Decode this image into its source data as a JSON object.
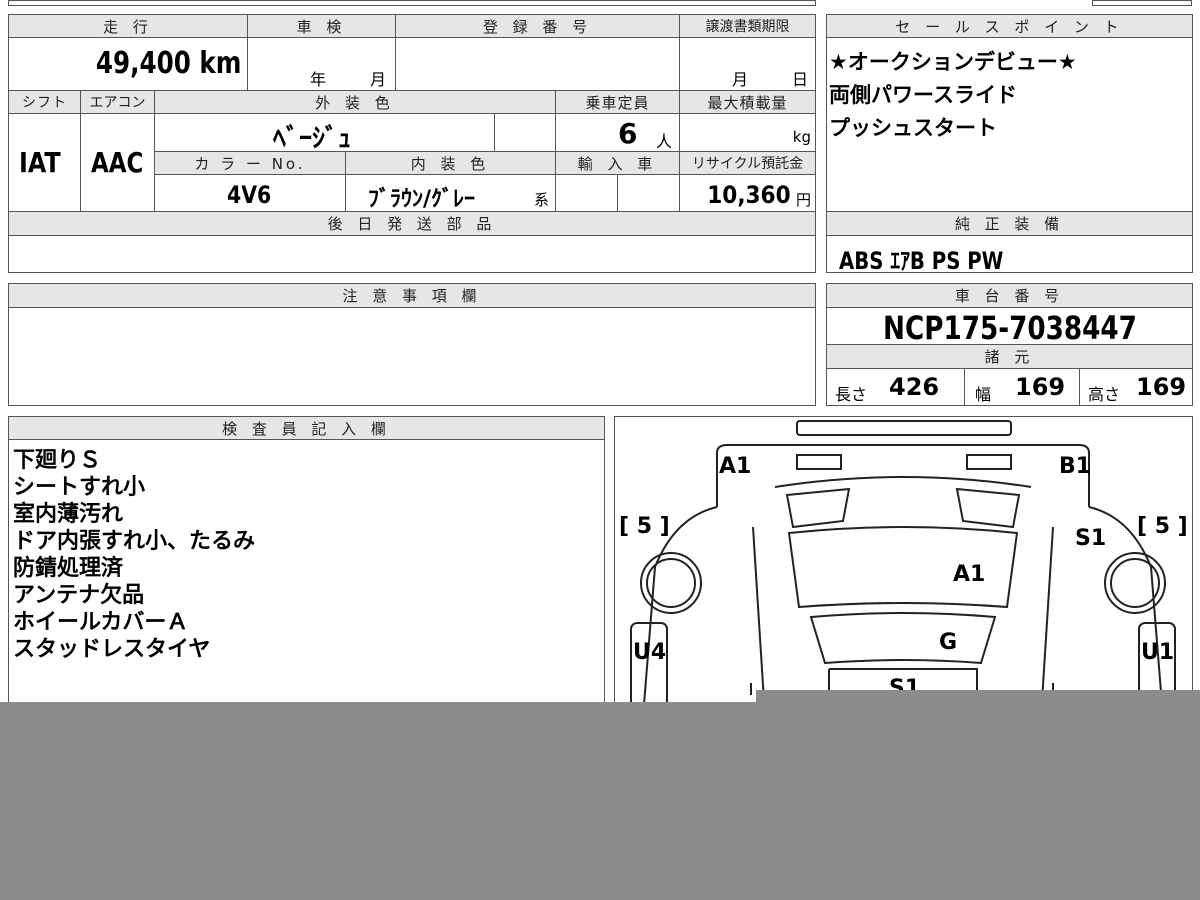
{
  "top_strip": {
    "partial_text": ""
  },
  "summary": {
    "headers": {
      "mileage": "走 行",
      "shaken": "車 検",
      "reg_number": "登 録 番 号",
      "transfer_deadline": "譲渡書類期限",
      "shift": "シフト",
      "aircon": "エアコン",
      "exterior_color": "外 装 色",
      "capacity": "乗車定員",
      "max_load": "最大積載量",
      "color_no": "カ ラ ー No.",
      "interior_color": "内 装 色",
      "import": "輸 入 車",
      "recycle": "リサイクル預託金",
      "later_parts": "後 日 発 送 部 品"
    },
    "values": {
      "mileage": "49,400 km",
      "shaken_year_unit": "年",
      "shaken_month_unit": "月",
      "deadline_month_unit": "月",
      "deadline_day_unit": "日",
      "shift": "IAT",
      "aircon": "AAC",
      "exterior_color": "ﾍﾞｰｼﾞｭ",
      "capacity": "6",
      "capacity_unit": "人",
      "max_load_unit": "kg",
      "color_no": "4V6",
      "interior_color": "ﾌﾞﾗｳﾝ/ｸﾞﾚｰ",
      "interior_suffix": "系",
      "recycle": "10,360",
      "recycle_unit": "円"
    }
  },
  "sales_points": {
    "header": "セ ー ル ス ポ イ ン ト",
    "lines": [
      "★オークションデビュー★",
      "両側パワースライド",
      "プッシュスタート"
    ]
  },
  "equipment": {
    "header": "純 正 装 備",
    "value": "ABS ｴｱB PS PW"
  },
  "caution": {
    "header": "注 意 事 項 欄"
  },
  "chassis": {
    "header": "車 台 番 号",
    "value": "NCP175-7038447",
    "spec_header": "諸 元",
    "length_label": "長さ",
    "length": "426",
    "width_label": "幅",
    "width": "169",
    "height_label": "高さ",
    "height": "169"
  },
  "inspector": {
    "header": "検 査 員 記 入 欄",
    "lines": [
      "下廻りＳ",
      "シートすれ小",
      "室内薄汚れ",
      "ドア内張すれ小、たるみ",
      "防錆処理済",
      "アンテナ欠品",
      "ホイールカバーＡ",
      "スタッドレスタイヤ"
    ]
  },
  "diagram": {
    "labels": {
      "front_left": "A1",
      "front_right": "B1",
      "tire_left": "[ 5 ]",
      "tire_right": "[ 5 ]",
      "side_right": "S1",
      "hood": "A1",
      "windshield": "G",
      "door_left": "U4",
      "door_right": "U1",
      "roof": "S1"
    }
  }
}
